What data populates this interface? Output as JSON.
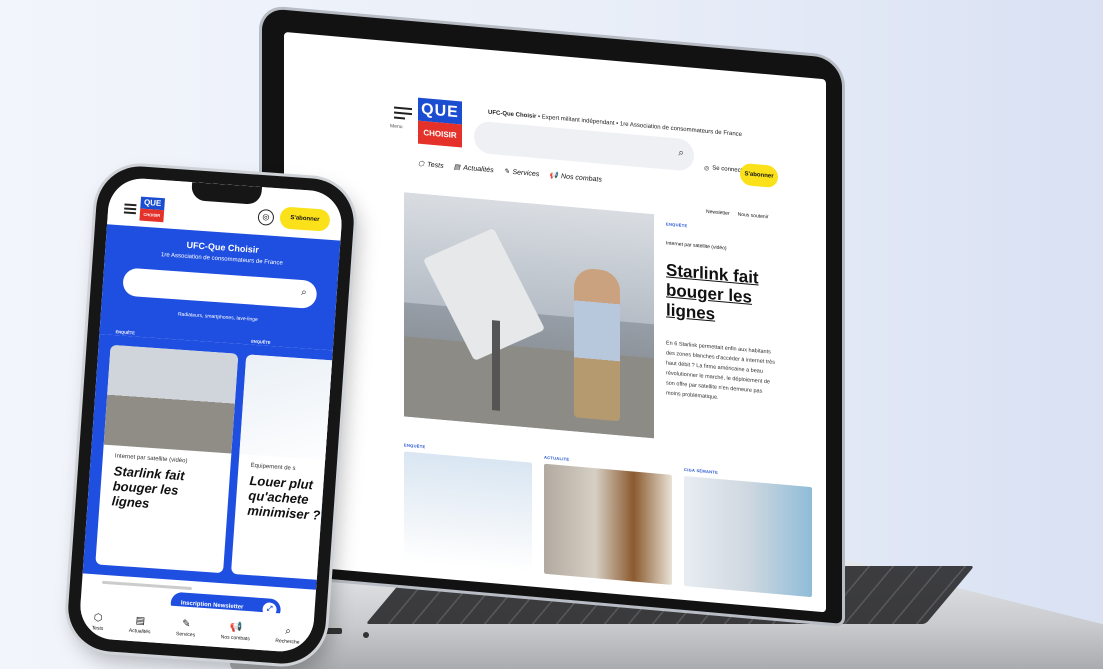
{
  "desktop": {
    "menu_label": "Menu",
    "logo": {
      "top": "QUE",
      "bottom": "CHOISIR"
    },
    "tagline_bold": "UFC-Que Choisir",
    "tagline_rest": " • Expert militant indépendant • 1re Association de consommateurs de France",
    "search_icon": "⌕",
    "nav": [
      {
        "icon": "⬡",
        "label": "Tests"
      },
      {
        "icon": "▤",
        "label": "Actualités"
      },
      {
        "icon": "✎",
        "label": "Services"
      },
      {
        "icon": "📢",
        "label": "Nos combats"
      }
    ],
    "login": "Se connecter",
    "login_icon": "◎",
    "subscribe": "S'abonner",
    "newsletter": "Newsletter",
    "support": "Nous soutenir",
    "hero": {
      "badge": "ENQUÊTE",
      "subtitle": "Internet par satellite (vidéo)",
      "title": "Starlink fait bouger les lignes",
      "body": "En 6 Starlink permettait enfin aux habitants des zones blanches d'accéder à internet très haut débit ? La firme américaine a beau révolutionner le marché, le déploiement de son offre par satellite n'en demeure pas moins problématique."
    },
    "cards": [
      {
        "badge": "ENQUÊTE"
      },
      {
        "badge": "ACTUALITÉ"
      },
      {
        "badge": "CIGA SÉMANTE"
      }
    ]
  },
  "mobile": {
    "logo": {
      "top": "QUE",
      "bottom": "CHOISIR"
    },
    "subscribe": "S'abonner",
    "site_title": "UFC-Que Choisir",
    "association": "1re Association de consommateurs de France",
    "search_hint": "Radiateurs, smartphones, lave-linge",
    "badges": [
      "ENQUÊTE",
      "ENQUÊTE"
    ],
    "cards": [
      {
        "caption": "Internet par satellite (vidéo)",
        "title": "Starlink fait bouger les lignes"
      },
      {
        "caption": "Équipement de s",
        "title": "Louer plut qu'achete minimiser ?"
      }
    ],
    "newsletter_button": "Inscription Newsletter",
    "bottom_nav": [
      {
        "icon": "⬡",
        "label": "Tests"
      },
      {
        "icon": "▤",
        "label": "Actualités"
      },
      {
        "icon": "✎",
        "label": "Services"
      },
      {
        "icon": "📢",
        "label": "Nos combats"
      },
      {
        "icon": "⌕",
        "label": "Recherche"
      }
    ]
  }
}
